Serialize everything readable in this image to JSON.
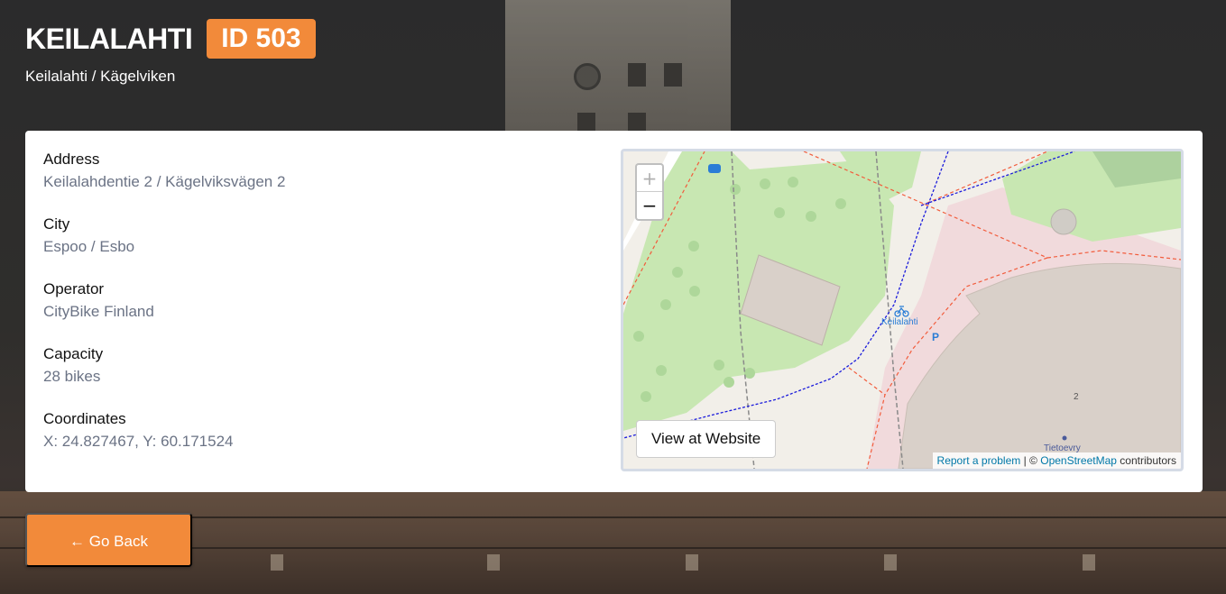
{
  "header": {
    "title": "KEILALAHTI",
    "id_badge": "ID 503",
    "subtitle": "Keilalahti / Kägelviken"
  },
  "details": [
    {
      "label": "Address",
      "value": "Keilalahdentie 2 / Kägelviksvägen 2"
    },
    {
      "label": "City",
      "value": "Espoo / Esbo"
    },
    {
      "label": "Operator",
      "value": "CityBike Finland"
    },
    {
      "label": "Capacity",
      "value": "28 bikes"
    },
    {
      "label": "Coordinates",
      "value": "X: 24.827467, Y: 60.171524"
    }
  ],
  "map": {
    "zoom_in_label": "+",
    "zoom_out_label": "−",
    "view_website_label": "View at Website",
    "station_label": "Keilalahti",
    "poi_label": "Tietoevry",
    "house_number": "2",
    "attribution": {
      "report_link": "Report a problem",
      "separator": "| ©",
      "osm_link": "OpenStreetMap",
      "suffix": "contributors"
    },
    "colors": {
      "park": "#c8e7b2",
      "building": "#d9d0c9",
      "commercial": "#f1dadc",
      "footway": "#f25c3c",
      "cycleway": "#1b1bdc"
    }
  },
  "back_button": {
    "label": "← Go Back"
  },
  "colors": {
    "accent": "#f28a3a"
  }
}
